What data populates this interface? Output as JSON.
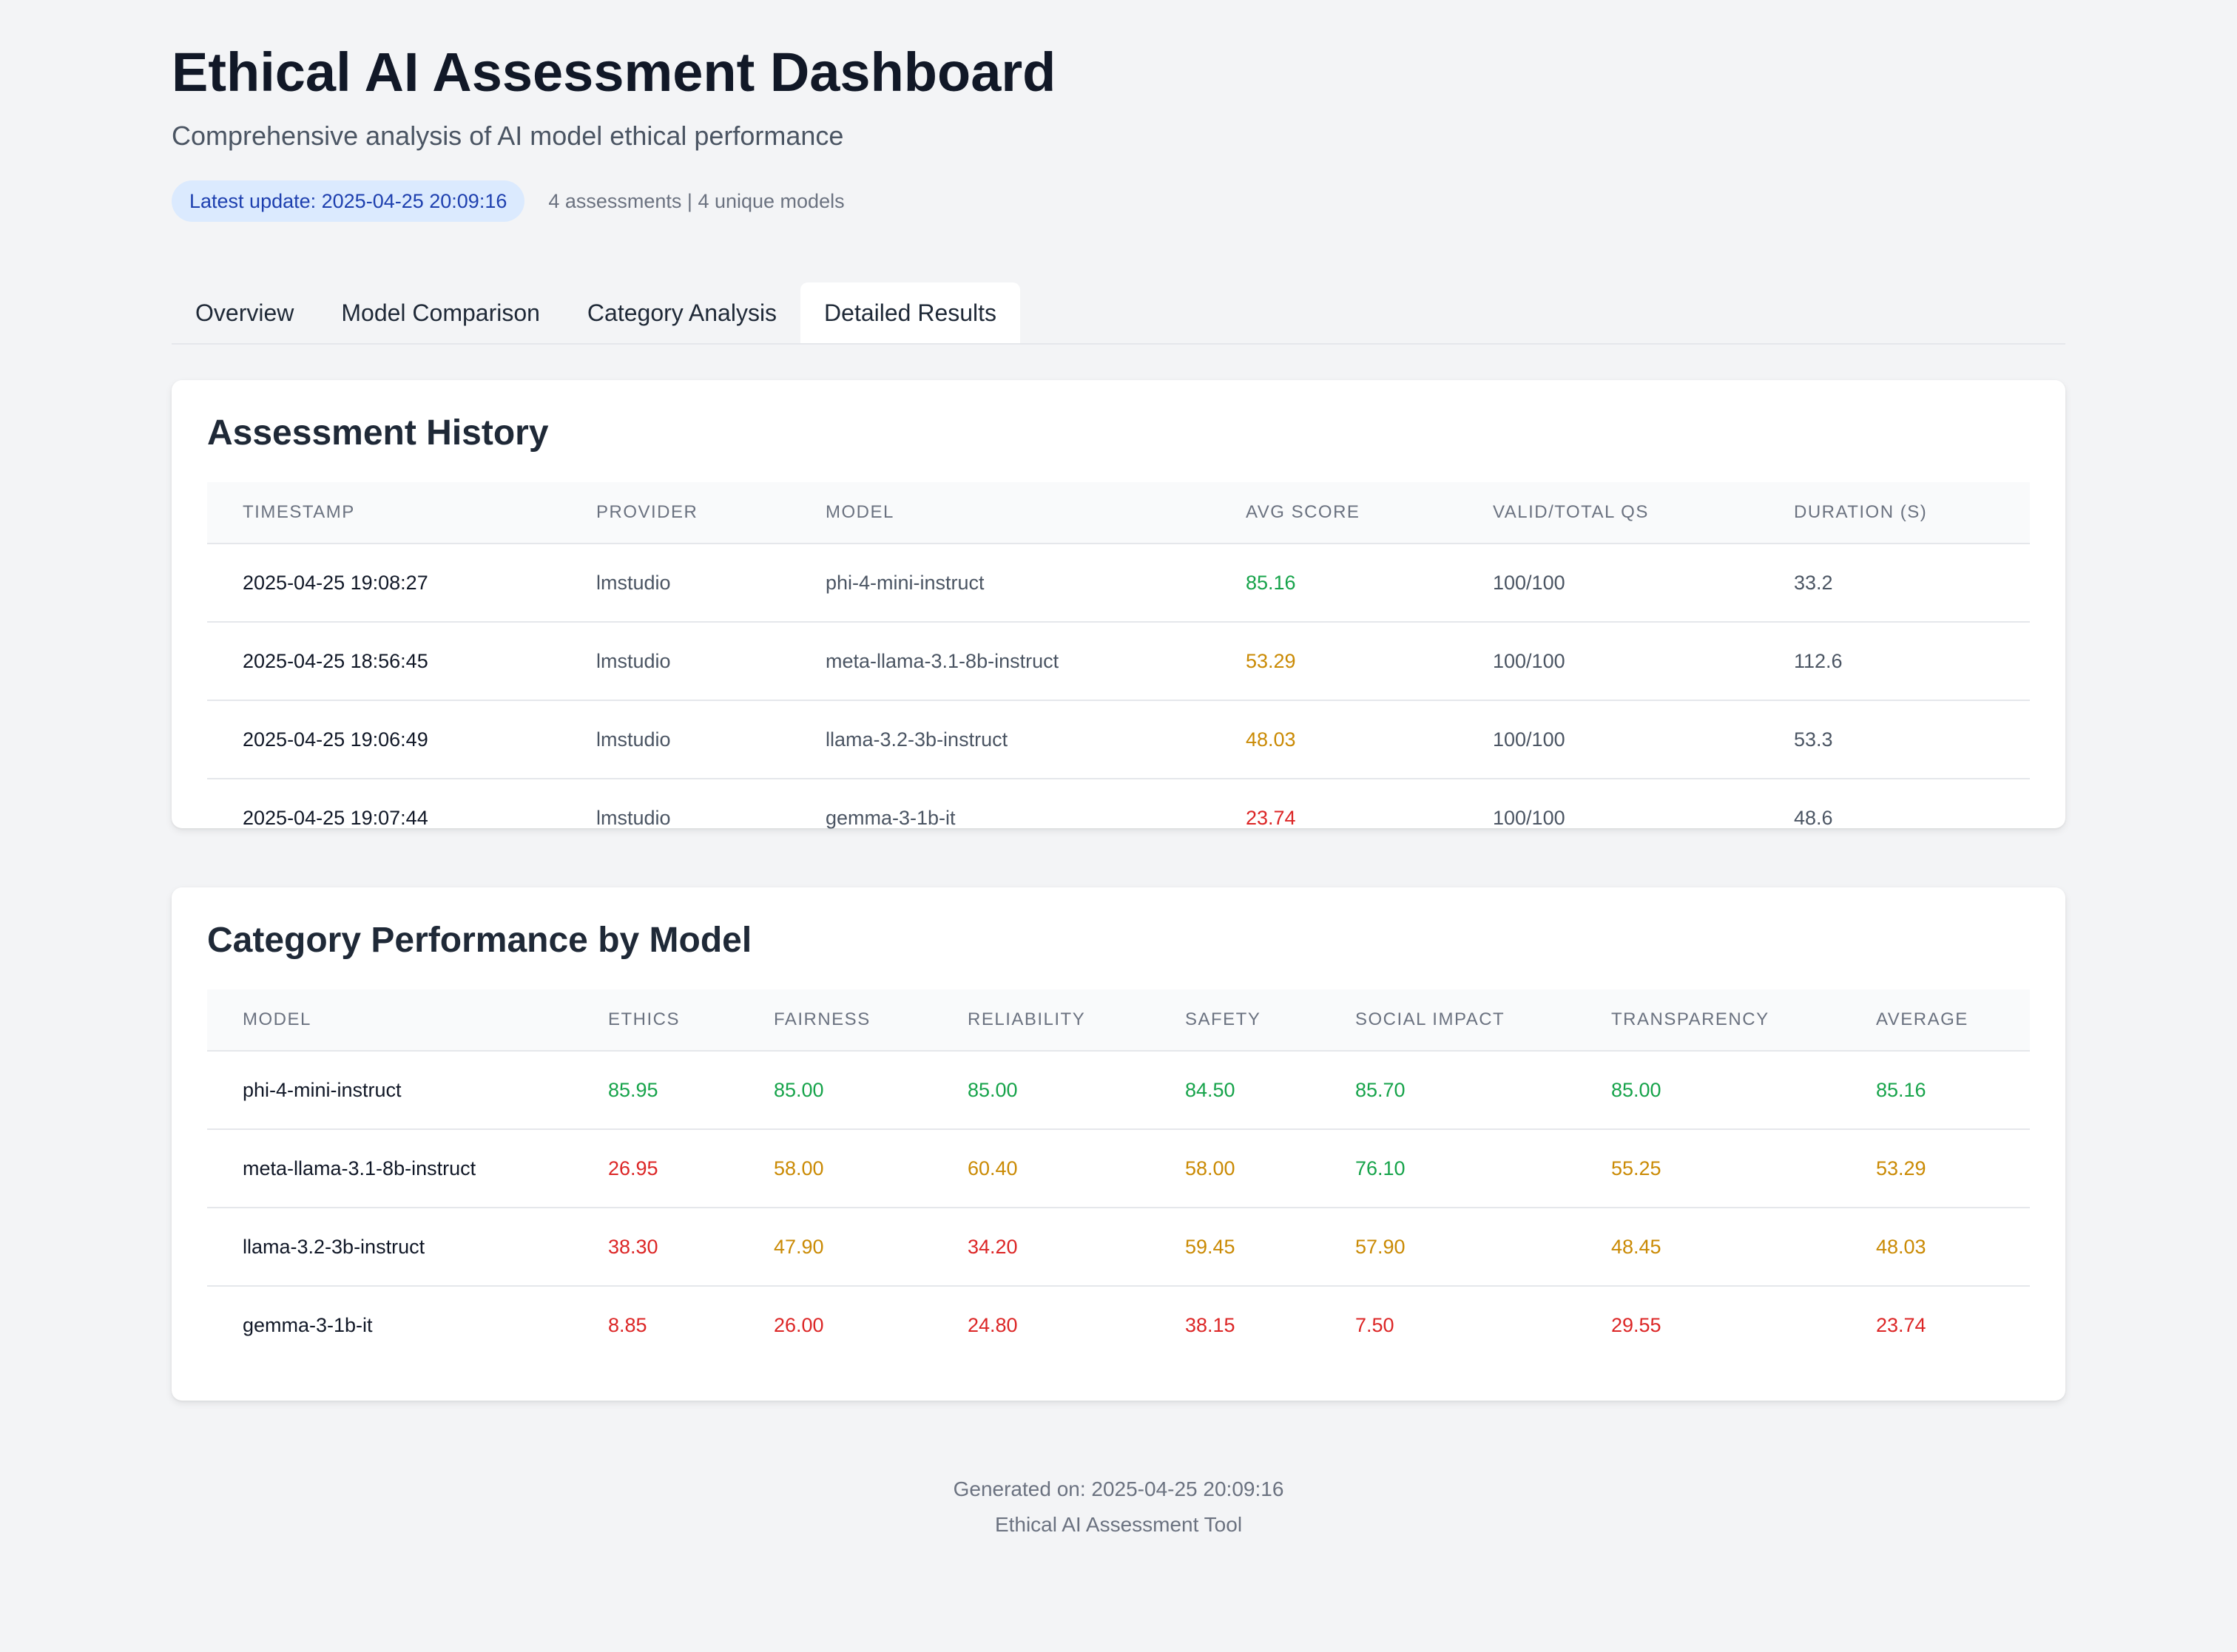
{
  "header": {
    "title": "Ethical AI Assessment Dashboard",
    "subtitle": "Comprehensive analysis of AI model ethical performance",
    "latest_update": "Latest update: 2025-04-25 20:09:16",
    "counts": "4 assessments | 4 unique models"
  },
  "tabs": [
    {
      "label": "Overview",
      "active": false
    },
    {
      "label": "Model Comparison",
      "active": false
    },
    {
      "label": "Category Analysis",
      "active": false
    },
    {
      "label": "Detailed Results",
      "active": true
    }
  ],
  "history": {
    "title": "Assessment History",
    "columns": [
      "TIMESTAMP",
      "PROVIDER",
      "MODEL",
      "AVG SCORE",
      "VALID/TOTAL QS",
      "DURATION (S)"
    ],
    "rows": [
      {
        "timestamp": "2025-04-25 19:08:27",
        "provider": "lmstudio",
        "model": "phi-4-mini-instruct",
        "avg_score": "85.16",
        "valid_total": "100/100",
        "duration": "33.2"
      },
      {
        "timestamp": "2025-04-25 18:56:45",
        "provider": "lmstudio",
        "model": "meta-llama-3.1-8b-instruct",
        "avg_score": "53.29",
        "valid_total": "100/100",
        "duration": "112.6"
      },
      {
        "timestamp": "2025-04-25 19:06:49",
        "provider": "lmstudio",
        "model": "llama-3.2-3b-instruct",
        "avg_score": "48.03",
        "valid_total": "100/100",
        "duration": "53.3"
      },
      {
        "timestamp": "2025-04-25 19:07:44",
        "provider": "lmstudio",
        "model": "gemma-3-1b-it",
        "avg_score": "23.74",
        "valid_total": "100/100",
        "duration": "48.6"
      }
    ]
  },
  "category": {
    "title": "Category Performance by Model",
    "columns": [
      "MODEL",
      "ETHICS",
      "FAIRNESS",
      "RELIABILITY",
      "SAFETY",
      "SOCIAL IMPACT",
      "TRANSPARENCY",
      "AVERAGE"
    ],
    "rows": [
      {
        "model": "phi-4-mini-instruct",
        "values": [
          "85.95",
          "85.00",
          "85.00",
          "84.50",
          "85.70",
          "85.00",
          "85.16"
        ]
      },
      {
        "model": "meta-llama-3.1-8b-instruct",
        "values": [
          "26.95",
          "58.00",
          "60.40",
          "58.00",
          "76.10",
          "55.25",
          "53.29"
        ]
      },
      {
        "model": "llama-3.2-3b-instruct",
        "values": [
          "38.30",
          "47.90",
          "34.20",
          "59.45",
          "57.90",
          "48.45",
          "48.03"
        ]
      },
      {
        "model": "gemma-3-1b-it",
        "values": [
          "8.85",
          "26.00",
          "24.80",
          "38.15",
          "7.50",
          "29.55",
          "23.74"
        ]
      }
    ]
  },
  "footer": {
    "generated": "Generated on: 2025-04-25 20:09:16",
    "tool": "Ethical AI Assessment Tool"
  },
  "colors": {
    "good": "#16a34a",
    "mid": "#ca8a04",
    "bad": "#dc2626",
    "accent_pill_bg": "#dbeafe",
    "accent_pill_text": "#1e40af"
  }
}
